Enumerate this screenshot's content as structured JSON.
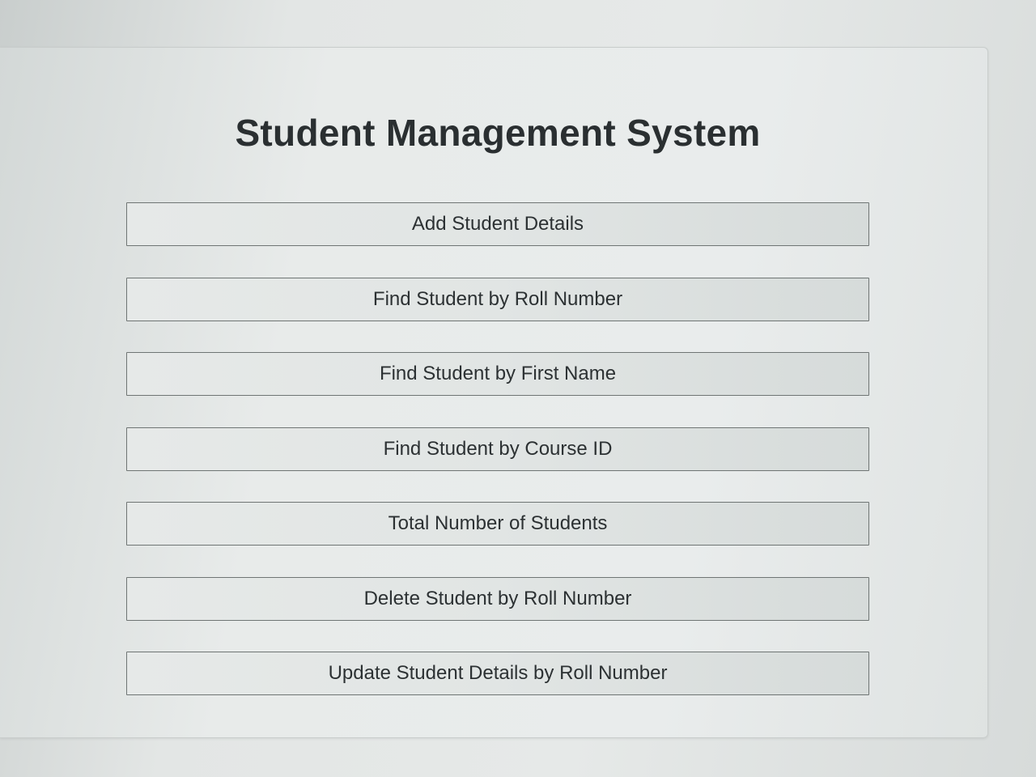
{
  "app": {
    "title": "Student Management System"
  },
  "menu": {
    "items": [
      {
        "label": "Add Student Details"
      },
      {
        "label": "Find Student by Roll Number"
      },
      {
        "label": "Find Student by First Name"
      },
      {
        "label": "Find Student by Course ID"
      },
      {
        "label": "Total Number of Students"
      },
      {
        "label": "Delete Student by Roll Number"
      },
      {
        "label": "Update Student Details by Roll Number"
      }
    ]
  }
}
